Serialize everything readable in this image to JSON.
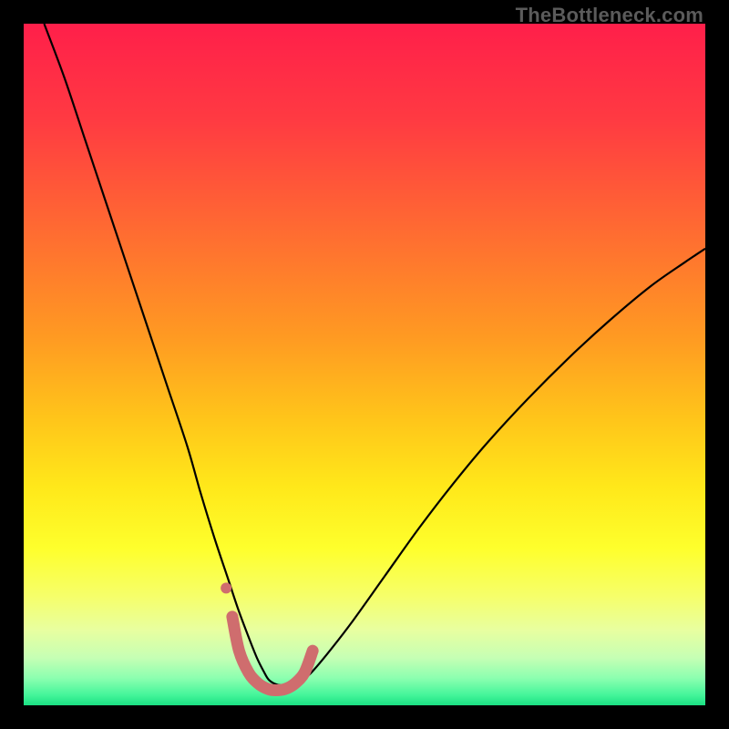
{
  "watermark": {
    "text": "TheBottleneck.com"
  },
  "chart_data": {
    "type": "line",
    "title": "",
    "xlabel": "",
    "ylabel": "",
    "xlim": [
      0,
      100
    ],
    "ylim": [
      0,
      100
    ],
    "grid": false,
    "legend": false,
    "background_gradient_stops": [
      {
        "offset": 0.0,
        "color": "#ff1f4a"
      },
      {
        "offset": 0.14,
        "color": "#ff3a42"
      },
      {
        "offset": 0.3,
        "color": "#ff6a32"
      },
      {
        "offset": 0.46,
        "color": "#ff9a22"
      },
      {
        "offset": 0.58,
        "color": "#ffc51a"
      },
      {
        "offset": 0.68,
        "color": "#ffe81a"
      },
      {
        "offset": 0.77,
        "color": "#feff2c"
      },
      {
        "offset": 0.84,
        "color": "#f6ff6a"
      },
      {
        "offset": 0.89,
        "color": "#e8ffa0"
      },
      {
        "offset": 0.93,
        "color": "#c6ffb4"
      },
      {
        "offset": 0.96,
        "color": "#8cffb0"
      },
      {
        "offset": 0.985,
        "color": "#44f59a"
      },
      {
        "offset": 1.0,
        "color": "#1adf83"
      }
    ],
    "series": [
      {
        "name": "bottleneck-curve",
        "stroke": "#000000",
        "stroke_width": 2.2,
        "x": [
          3,
          6,
          9,
          12,
          15,
          18,
          21,
          24,
          26,
          28,
          30,
          31.5,
          33,
          34.2,
          35.2,
          36,
          37.3,
          38.8,
          40.3,
          42,
          44.5,
          48,
          53,
          58,
          63,
          68,
          74,
          80,
          86,
          92,
          97,
          100
        ],
        "y": [
          100,
          92,
          83,
          74,
          65,
          56,
          47,
          38,
          31,
          24.5,
          18.5,
          14,
          10,
          7,
          5,
          3.7,
          3,
          3,
          3.3,
          4.6,
          7.5,
          12,
          19,
          26,
          32.5,
          38.5,
          45,
          51,
          56.5,
          61.5,
          65,
          67
        ]
      },
      {
        "name": "highlight-band",
        "stroke": "#cf6d6e",
        "stroke_width": 13,
        "linecap": "round",
        "x": [
          30.6,
          31.6,
          33.0,
          34.4,
          35.8,
          37.0,
          38.4,
          39.8,
          41.2,
          42.4
        ],
        "y": [
          13.0,
          8.0,
          4.8,
          3.2,
          2.4,
          2.2,
          2.4,
          3.2,
          4.8,
          8.0
        ]
      },
      {
        "name": "highlight-dot",
        "type": "scatter",
        "fill": "#cf6d6e",
        "x": [
          29.7
        ],
        "y": [
          17.2
        ],
        "r": 6
      }
    ]
  }
}
